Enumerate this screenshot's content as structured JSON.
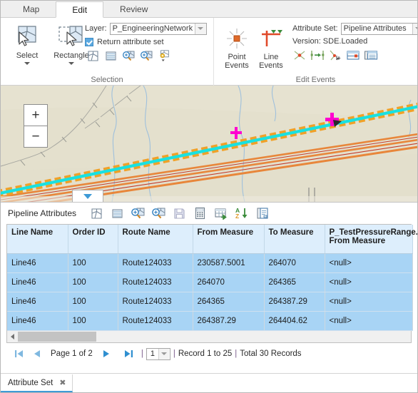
{
  "ribbon": {
    "tabs": [
      {
        "label": "Map",
        "active": false
      },
      {
        "label": "Edit",
        "active": true
      },
      {
        "label": "Review",
        "active": false
      }
    ],
    "selection_group": {
      "title": "Selection",
      "select_label": "Select",
      "rectangle_label": "Rectangle",
      "layer_label": "Layer:",
      "layer_value": "P_EngineeringNetwork",
      "checkbox_label": "Return attribute set",
      "checkbox_checked": true,
      "small_buttons": [
        "select-features-icon",
        "select-by-attributes-icon",
        "zoom-to-selection-icon",
        "zoom-to-selection-alt-icon",
        "selection-options-icon"
      ]
    },
    "edit_events_group": {
      "title": "Edit Events",
      "point_events_label": "Point Events",
      "line_events_label": "Line Events",
      "attribute_set_label": "Attribute Set:",
      "attribute_set_value": "Pipeline Attributes",
      "version_label": "Version: SDE.Loaded",
      "small_buttons": [
        "retire-event-icon",
        "extend-event-icon",
        "realign-event-icon",
        "split-event-icon",
        "event-attributes-icon"
      ]
    }
  },
  "map": {
    "zoom_in_label": "+",
    "zoom_out_label": "−",
    "toggle_name": "collapse-panel-toggle",
    "colors": {
      "background": "#e4e0cd",
      "route_highlight": "#19e1e1",
      "route_dash": "#f5a623",
      "pipeline": "#e06a2a",
      "stream": "#8fb8d8",
      "marker": "#ff00d0"
    }
  },
  "table_panel": {
    "title": "Pipeline Attributes",
    "toolbar_buttons": [
      "select-features-icon",
      "show-all-records-icon",
      "zoom-to-selected-icon",
      "pan-to-selected-icon",
      "save-edits-icon",
      "calculate-field-icon",
      "export-table-icon",
      "sort-ascending-icon",
      "field-properties-icon"
    ],
    "columns": [
      "Line Name",
      "Order ID",
      "Route Name",
      "From Measure",
      "To Measure",
      "P_TestPressureRange.\nFrom Measure"
    ],
    "rows": [
      {
        "line_name": "Line46",
        "order_id": "100",
        "route_name": "Route124033",
        "from_measure": "230587.5001",
        "to_measure": "264070",
        "p_test": "<null>",
        "selected": true
      },
      {
        "line_name": "Line46",
        "order_id": "100",
        "route_name": "Route124033",
        "from_measure": "264070",
        "to_measure": "264365",
        "p_test": "<null>",
        "selected": true
      },
      {
        "line_name": "Line46",
        "order_id": "100",
        "route_name": "Route124033",
        "from_measure": "264365",
        "to_measure": "264387.29",
        "p_test": "<null>",
        "selected": true
      },
      {
        "line_name": "Line46",
        "order_id": "100",
        "route_name": "Route124033",
        "from_measure": "264387.29",
        "to_measure": "264404.62",
        "p_test": "<null>",
        "selected": true
      }
    ]
  },
  "pager": {
    "first_label": "first-page",
    "prev_label": "previous-page",
    "page_text": "Page 1 of 2",
    "next_label": "next-page",
    "last_label": "last-page",
    "sep": "|",
    "page_value": "1",
    "record_range": "Record 1 to 25",
    "total_records": "Total 30 Records"
  },
  "dock_tabs": [
    {
      "label": "Attribute Set",
      "close": "✖"
    }
  ]
}
